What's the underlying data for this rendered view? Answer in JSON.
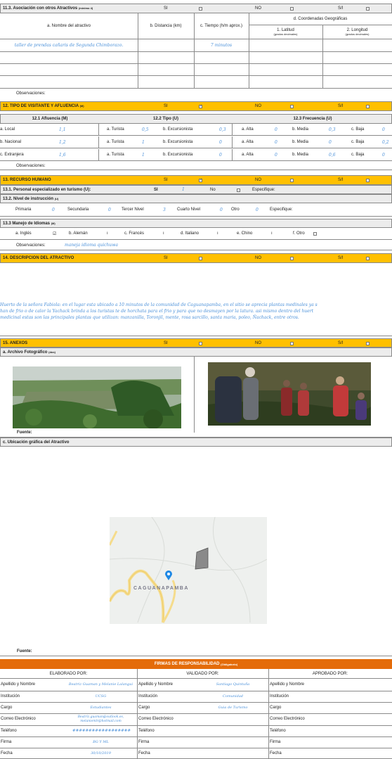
{
  "s11": {
    "title": "11.3. Asociación con otros Atractivos",
    "title_note": "(mínimo 4)",
    "si": "SI",
    "no": "NO",
    "si_no": "S/I",
    "col_name": "a. Nombre del atractivo",
    "col_dist": "b. Distancia (km)",
    "col_time": "c. Tiempo (h/m aprox.)",
    "col_coord": "d. Coordenadas Geográficas",
    "col_lat": "1. Latitud",
    "col_lat_note": "(grados decimales)",
    "col_lon": "2. Longitud",
    "col_lon_note": "(grados decimales)",
    "row1_name": "taller de prendas cañaris de Segunda Chimborazo.",
    "row1_time": "7 minutos",
    "obs": "Observaciones:"
  },
  "s12": {
    "title": "12. TIPO DE VISITANTE Y AFLUENCIA",
    "title_note": "(M)",
    "si": "SI",
    "no": "NO",
    "si_no": "S/I",
    "h1": "12.1 Afluencia (M)",
    "h2": "12.2 Tipo (U)",
    "h3": "12.3 Frecuencia (U)",
    "rows": [
      {
        "name": "a. Local",
        "afl": "1,1",
        "tur": "0,5",
        "exc": "0,3",
        "alta": "0",
        "media": "0,3",
        "baja": "0"
      },
      {
        "name": "b. Nacional",
        "afl": "1,2",
        "tur": "1",
        "exc": "0",
        "alta": "0",
        "media": "0",
        "baja": "0,2"
      },
      {
        "name": "c. Extranjera",
        "afl": "1,6",
        "tur": "1",
        "exc": "0",
        "alta": "0",
        "media": "0,6",
        "baja": "0"
      }
    ],
    "l_tur": "a. Turista",
    "l_exc": "b. Excursionista",
    "l_alta": "a. Alta",
    "l_media": "b. Media",
    "l_baja": "c. Baja",
    "obs": "Observaciones:"
  },
  "s13": {
    "title": "13. RECURSO HUMANO",
    "si": "SI",
    "no": "NO",
    "si_no": "S/I",
    "p1": "13.1. Personal especializado en turismo (U):",
    "p1_si": "SI",
    "p1_si_val": "1",
    "p1_no": "No",
    "p1_esp": "Especifique:",
    "p2": "13.2. Nivel de instrucción",
    "p2_note": "(U)",
    "prim": "Primaria",
    "prim_v": "0",
    "sec": "Secundaria",
    "sec_v": "0",
    "ter": "Tercer Nivel",
    "ter_v": "3",
    "cua": "Cuarto Nivel",
    "cua_v": "0",
    "otro": "Otro",
    "otro_v": "0",
    "esp": "Especifique:",
    "p3": "13.3 Manejo de Idiomas",
    "p3_note": "(M)",
    "ing": "a. Inglés",
    "ale": "b. Alemán",
    "fra": "c. Francés",
    "ita": "d. Italiano",
    "chi": "e. Chino",
    "otr": "f. Otro",
    "obs": "Observaciones:",
    "obs_val": "maneja idioma quichuwa"
  },
  "s14": {
    "title": "14. DESCRIPCION DEL ATRACTIVO",
    "si": "SI",
    "no": "NO",
    "si_no": "S/I",
    "text1": "Huerto de la señora Fabiola: en el lugar esta ubicado a 10 minutos de la comunidad de Caguanapamba, en el sitio se aprecia plantas medinales ya s",
    "text2": "han de frio o de calor la Yachack brinda a los turistas te de horchata para el frio y para que no desmayen por la latura. asi mismo dentro del huert",
    "text3": "medicinal estas son las principales plantas que utilizan: manzanilla, Toronjil, mente, rosa sarcillo, santa maria, poleo, Ñachack, entre otros."
  },
  "s15": {
    "title": "15. ANEXOS",
    "si": "SI",
    "no": "NO",
    "si_no": "S/I",
    "archivo": "a. Archivo Fotográfico",
    "archivo_note": "(dos)",
    "fuente1": "Fuente:",
    "ubicacion": "c. Ubicación gráfica del Atractivo",
    "map_label": "CAGUANAPAMBA",
    "fuente2": "Fuente:"
  },
  "firmas": {
    "title": "FIRMAS DE RESPONSABILIDAD",
    "title_note": "(Obligatorio)",
    "elab": "ELABORADO POR:",
    "valid": "VALIDADO POR:",
    "aprob": "APROBADO POR:",
    "l_apellido": "Apellido y Nombre",
    "l_inst": "Institución",
    "l_cargo": "Cargo",
    "l_correo": "Correo Electrónico",
    "l_tel": "Teléfono",
    "l_firma": "Firma",
    "l_fecha": "Fecha",
    "e_apellido": "Beatriz Guaman y Melanie Lalangui",
    "e_inst": "UCSG",
    "e_cargo": "Estudiantes",
    "e_correo": "Beatriz.guaman@outlook.es, melaniemlr@hotmail.com",
    "e_tel": "##################",
    "e_firma": "BG Y ML",
    "e_fecha": "30/10/2019",
    "v_apellido": "Santiago Quintuña",
    "v_inst": "Comunidad",
    "v_cargo": "Guia de Turismo"
  },
  "colors": {
    "gold": "#ffc000",
    "orange": "#e46c0a",
    "blue_text": "#4a90d9",
    "gray": "#ececec"
  }
}
